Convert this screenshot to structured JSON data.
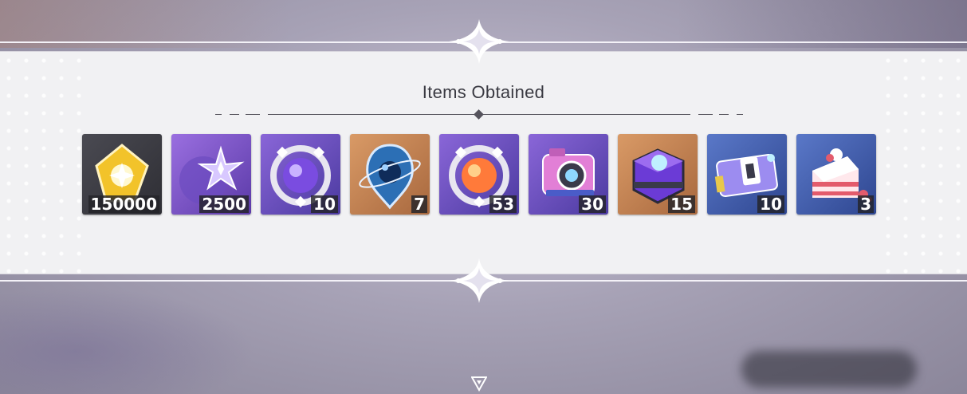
{
  "header": {
    "title": "Items Obtained"
  },
  "items": [
    {
      "name": "gold-crystal",
      "count": "150000",
      "bg": "#3a3a40",
      "accent": "#f2c32a"
    },
    {
      "name": "star-fragment",
      "count": "2500",
      "bg": "#7a4fc2",
      "accent": "#c9b2ff"
    },
    {
      "name": "purple-orb-ring",
      "count": "10",
      "bg": "#6a4cc0",
      "accent": "#9f7dff"
    },
    {
      "name": "planet-badge",
      "count": "7",
      "bg": "#c98a5a",
      "accent": "#2c6fb5"
    },
    {
      "name": "orange-orb-ring",
      "count": "53",
      "bg": "#6a4cc0",
      "accent": "#ff7a3a"
    },
    {
      "name": "camera",
      "count": "30",
      "bg": "#6a4cc0",
      "accent": "#e27fd6"
    },
    {
      "name": "data-box",
      "count": "15",
      "bg": "#c98a5a",
      "accent": "#6b3bd6"
    },
    {
      "name": "ticket-card",
      "count": "10",
      "bg": "#3e5aa8",
      "accent": "#7fc9ff"
    },
    {
      "name": "cake-slice",
      "count": "3",
      "bg": "#3e5aa8",
      "accent": "#e35b6c"
    }
  ],
  "icons": {
    "top": "sparkle-emblem-icon",
    "bottom": "sparkle-emblem-icon",
    "continue": "down-triangle-icon"
  }
}
